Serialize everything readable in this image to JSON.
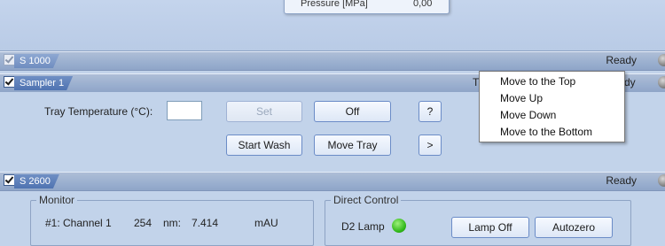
{
  "top_panel": {
    "popup_label": "Pressure [MPa]",
    "popup_value": "0,00"
  },
  "s1000": {
    "tab_label": "S 1000",
    "checked": true,
    "status": "Ready"
  },
  "sampler": {
    "tab_label": "Sampler 1",
    "checked": true,
    "status_prefix": "T",
    "status_suffix": "dy",
    "tray_temp_label": "Tray Temperature (°C):",
    "tray_temp_value": "",
    "set_label": "Set",
    "off_label": "Off",
    "help_label": "?",
    "start_wash_label": "Start Wash",
    "move_tray_label": "Move Tray",
    "more_label": ">"
  },
  "context_menu": {
    "items": [
      "Move to the Top",
      "Move Up",
      "Move Down",
      "Move to the Bottom"
    ]
  },
  "s2600": {
    "tab_label": "S 2600",
    "checked": true,
    "status": "Ready",
    "monitor_title": "Monitor",
    "channel_label": "#1: Channel 1",
    "wavelength": "254",
    "wavelength_unit": "nm:",
    "value": "7.414",
    "value_unit": "mAU",
    "direct_control_title": "Direct Control",
    "d2_lamp_label": "D2 Lamp",
    "lamp_off_label": "Lamp Off",
    "autozero_label": "Autozero"
  },
  "colors": {
    "accent_tab": "#4f73b1",
    "lamp_on": "#2fb618",
    "background": "#c2d3ea"
  }
}
